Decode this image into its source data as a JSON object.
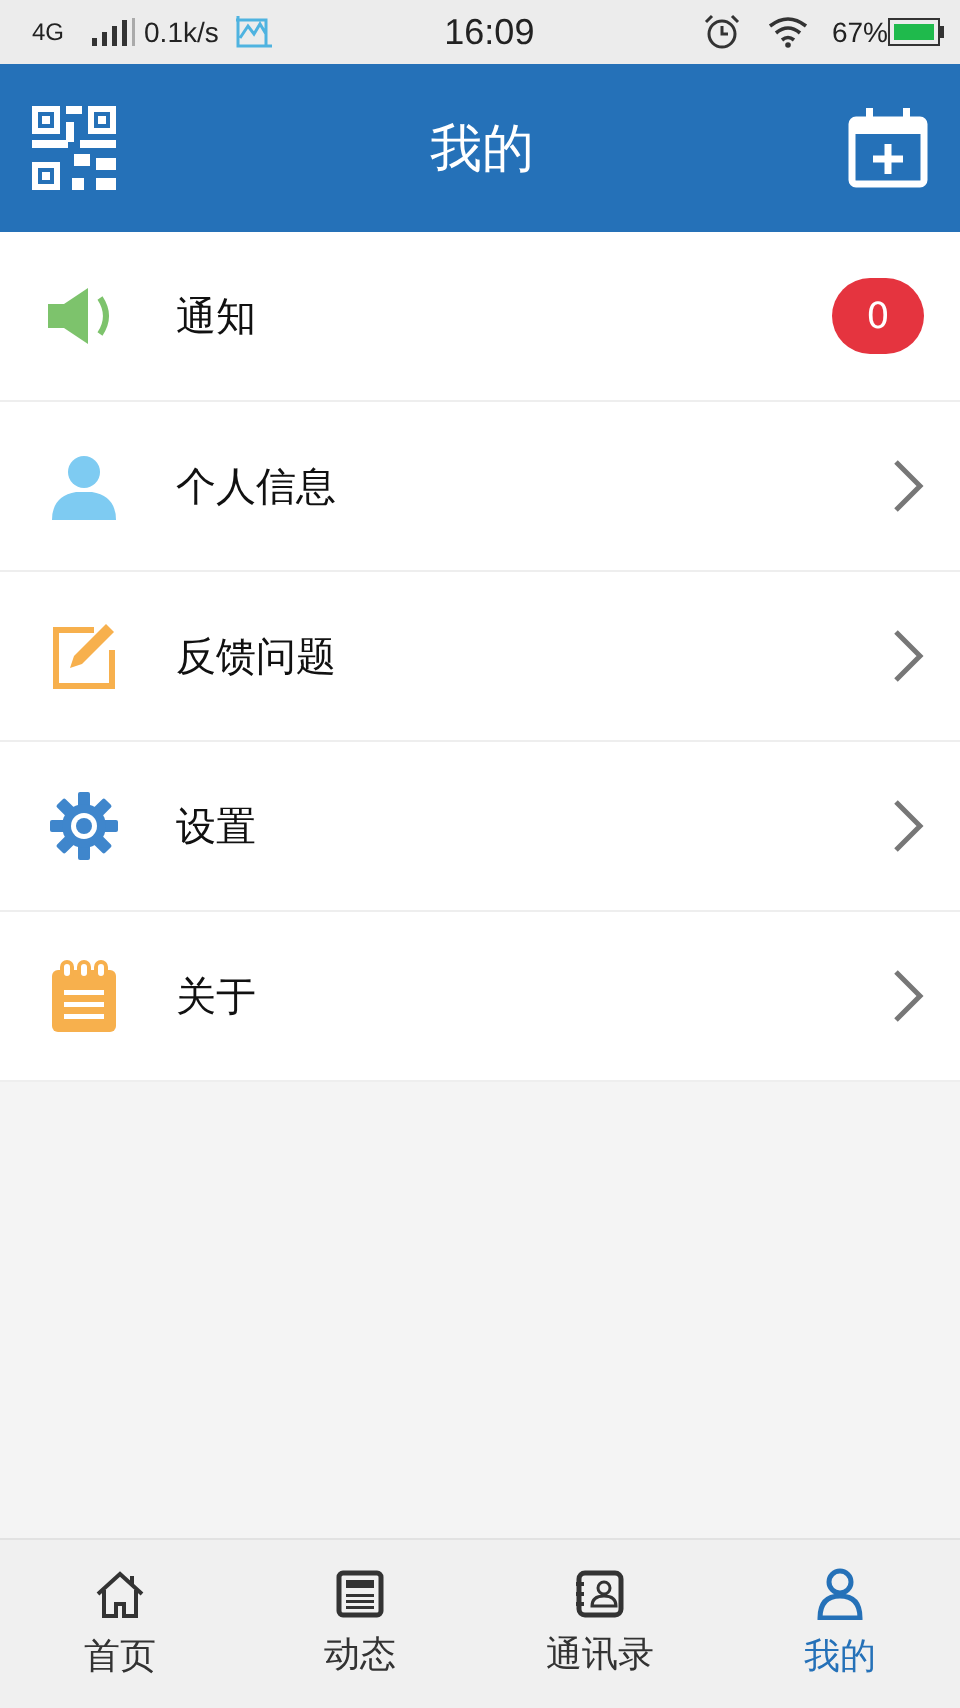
{
  "status_bar": {
    "network": "4G",
    "speed": "0.1k/s",
    "time": "16:09",
    "battery": "67%"
  },
  "header": {
    "title": "我的"
  },
  "menu": [
    {
      "label": "通知",
      "kind": "badge",
      "badge": "0"
    },
    {
      "label": "个人信息",
      "kind": "arrow"
    },
    {
      "label": "反馈问题",
      "kind": "arrow"
    },
    {
      "label": "设置",
      "kind": "arrow"
    },
    {
      "label": "关于",
      "kind": "arrow"
    }
  ],
  "tab_bar": [
    {
      "label": "首页",
      "selected": false
    },
    {
      "label": "动态",
      "selected": false
    },
    {
      "label": "通讯录",
      "selected": false
    },
    {
      "label": "我的",
      "selected": true
    }
  ]
}
